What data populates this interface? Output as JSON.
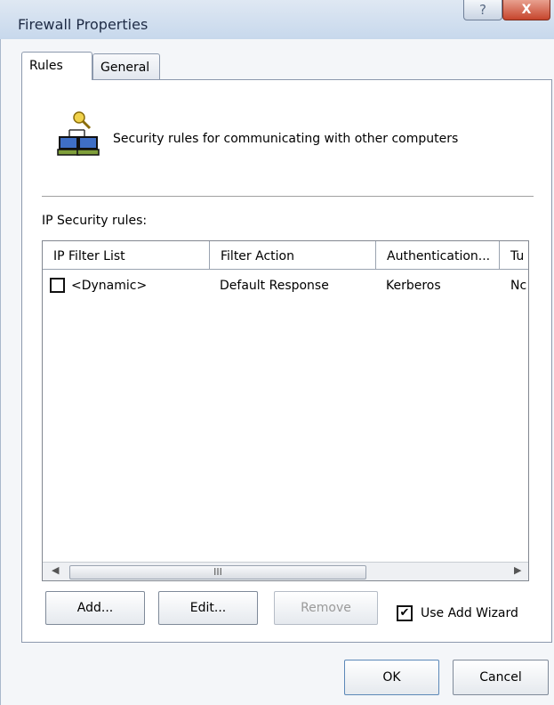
{
  "window": {
    "title": "Firewall Properties",
    "help_label": "?",
    "close_label": "X"
  },
  "tabs": [
    {
      "label": "Rules",
      "selected": true
    },
    {
      "label": "General",
      "selected": false
    }
  ],
  "header": {
    "icon": "network-computers-key-icon",
    "text": "Security rules for communicating with other computers"
  },
  "rules_section": {
    "label": "IP Security rules:",
    "columns": [
      "IP Filter List",
      "Filter Action",
      "Authentication...",
      "Tu"
    ],
    "rows": [
      {
        "checked": false,
        "ip_filter_list": "<Dynamic>",
        "filter_action": "Default Response",
        "authentication": "Kerberos",
        "tunnel": "Nc"
      }
    ],
    "scrollbar": {
      "left_arrow": "◀",
      "right_arrow": "▶",
      "thumb_grip": "III"
    }
  },
  "actions": {
    "add_label": "Add...",
    "edit_label": "Edit...",
    "remove_label": "Remove",
    "remove_enabled": false,
    "wizard_label": "Use Add Wizard",
    "wizard_checked": true
  },
  "footer": {
    "ok_label": "OK",
    "cancel_label": "Cancel"
  },
  "colors": {
    "title_bar": "#c7d8ec",
    "close_button": "#c6452d",
    "disabled_text": "#9a9a9a"
  }
}
